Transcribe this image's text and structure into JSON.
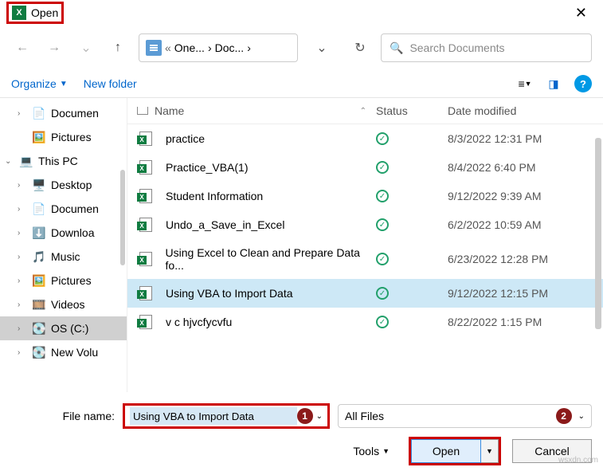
{
  "title": "Open",
  "path": {
    "segments": [
      "One...",
      "Doc..."
    ]
  },
  "search": {
    "placeholder": "Search Documents"
  },
  "toolbar": {
    "organize": "Organize",
    "new_folder": "New folder"
  },
  "tree": [
    {
      "icon": "📄",
      "label": "Documen",
      "chev": "›",
      "indent": 1
    },
    {
      "icon": "🖼️",
      "label": "Pictures",
      "chev": "",
      "indent": 1
    },
    {
      "icon": "💻",
      "label": "This PC",
      "chev": "⌄",
      "indent": 0,
      "bold": true
    },
    {
      "icon": "🖥️",
      "label": "Desktop",
      "chev": "›",
      "indent": 1
    },
    {
      "icon": "📄",
      "label": "Documen",
      "chev": "›",
      "indent": 1
    },
    {
      "icon": "⬇️",
      "label": "Downloa",
      "chev": "›",
      "indent": 1
    },
    {
      "icon": "🎵",
      "label": "Music",
      "chev": "›",
      "indent": 1
    },
    {
      "icon": "🖼️",
      "label": "Pictures",
      "chev": "›",
      "indent": 1
    },
    {
      "icon": "🎞️",
      "label": "Videos",
      "chev": "›",
      "indent": 1
    },
    {
      "icon": "💽",
      "label": "OS (C:)",
      "chev": "›",
      "indent": 1,
      "selected": true
    },
    {
      "icon": "💽",
      "label": "New Volu",
      "chev": "›",
      "indent": 1
    }
  ],
  "columns": {
    "name": "Name",
    "status": "Status",
    "date": "Date modified"
  },
  "files": [
    {
      "name": "practice",
      "date": "8/3/2022 12:31 PM"
    },
    {
      "name": "Practice_VBA(1)",
      "date": "8/4/2022 6:40 PM"
    },
    {
      "name": "Student Information",
      "date": "9/12/2022 9:39 AM"
    },
    {
      "name": "Undo_a_Save_in_Excel",
      "date": "6/2/2022 10:59 AM"
    },
    {
      "name": "Using Excel to Clean and Prepare Data fo...",
      "date": "6/23/2022 12:28 PM"
    },
    {
      "name": "Using VBA to Import Data",
      "date": "9/12/2022 12:15 PM",
      "selected": true
    },
    {
      "name": "v c hjvcfycvfu",
      "date": "8/22/2022 1:15 PM"
    }
  ],
  "footer": {
    "filename_label": "File name:",
    "filename_value": "Using VBA to Import Data",
    "filter": "All Files",
    "tools": "Tools",
    "open": "Open",
    "cancel": "Cancel",
    "badge1": "1",
    "badge2": "2"
  },
  "watermark": "wsxdn.com"
}
